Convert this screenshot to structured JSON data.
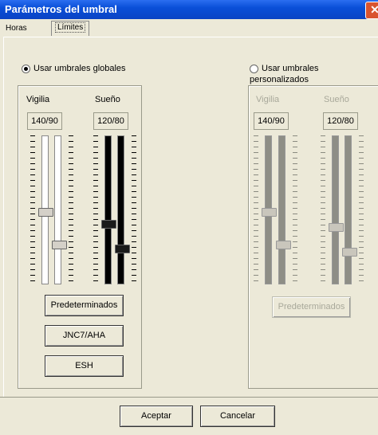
{
  "window": {
    "title": "Parámetros del umbral",
    "close_glyph": "✕"
  },
  "tabs": [
    {
      "label": "Horas"
    },
    {
      "label": "Límites"
    }
  ],
  "global": {
    "radio_label": "Usar umbrales globales",
    "columns": [
      {
        "label": "Vigilia",
        "value": "140/90",
        "thumbs": [
          0.52,
          0.74
        ]
      },
      {
        "label": "Sueño",
        "value": "120/80",
        "thumbs": [
          0.6,
          0.77
        ]
      }
    ],
    "buttons": [
      "Predeterminados",
      "JNC7/AHA",
      "ESH"
    ]
  },
  "custom": {
    "radio_label": "Usar umbrales personalizados",
    "columns": [
      {
        "label": "Vigilia",
        "value": "140/90",
        "thumbs": [
          0.52,
          0.74
        ]
      },
      {
        "label": "Sueño",
        "value": "120/80",
        "thumbs": [
          0.62,
          0.79
        ]
      }
    ],
    "buttons": [
      "Predeterminados"
    ]
  },
  "footer": {
    "accept_label": "Aceptar",
    "cancel_label": "Cancelar"
  }
}
